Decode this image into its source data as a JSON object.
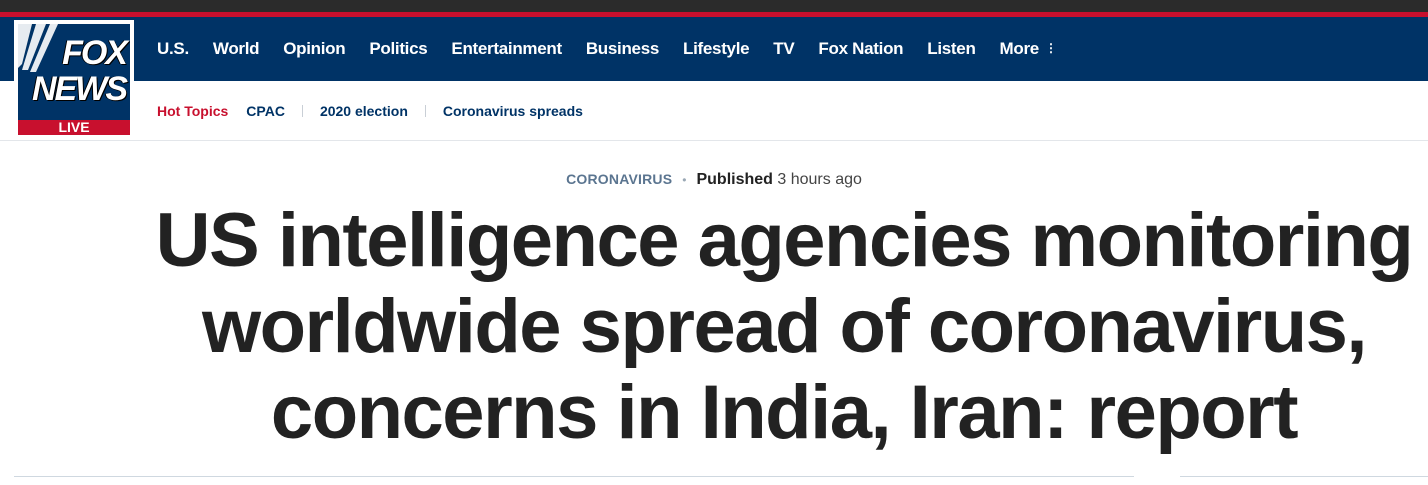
{
  "brand": {
    "logo_top": "FOX",
    "logo_bottom": "NEWS",
    "logo_live": "LIVE"
  },
  "colors": {
    "nav_background": "#003366",
    "accent_red": "#c8102e",
    "headline_text": "#222222",
    "category_text": "#5b7590"
  },
  "nav": {
    "items": [
      "U.S.",
      "World",
      "Opinion",
      "Politics",
      "Entertainment",
      "Business",
      "Lifestyle",
      "TV",
      "Fox Nation",
      "Listen",
      "More"
    ],
    "more_icon": "vertical-dots-icon"
  },
  "hot_topics": {
    "label": "Hot Topics",
    "links": [
      "CPAC",
      "2020 election",
      "Coronavirus spreads"
    ]
  },
  "article": {
    "category": "CORONAVIRUS",
    "published_label": "Published",
    "published_time": "3 hours ago",
    "headline_lines": [
      "US intelligence agencies monitoring",
      "worldwide spread of coronavirus,",
      "concerns in India, Iran: report"
    ]
  }
}
